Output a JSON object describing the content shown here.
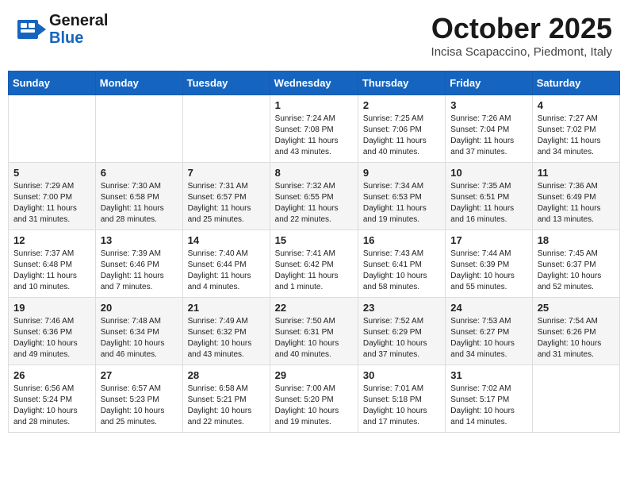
{
  "header": {
    "logo_line1": "General",
    "logo_line2": "Blue",
    "month_title": "October 2025",
    "location": "Incisa Scapaccino, Piedmont, Italy"
  },
  "weekdays": [
    "Sunday",
    "Monday",
    "Tuesday",
    "Wednesday",
    "Thursday",
    "Friday",
    "Saturday"
  ],
  "weeks": [
    [
      {
        "day": "",
        "info": ""
      },
      {
        "day": "",
        "info": ""
      },
      {
        "day": "",
        "info": ""
      },
      {
        "day": "1",
        "info": "Sunrise: 7:24 AM\nSunset: 7:08 PM\nDaylight: 11 hours and 43 minutes."
      },
      {
        "day": "2",
        "info": "Sunrise: 7:25 AM\nSunset: 7:06 PM\nDaylight: 11 hours and 40 minutes."
      },
      {
        "day": "3",
        "info": "Sunrise: 7:26 AM\nSunset: 7:04 PM\nDaylight: 11 hours and 37 minutes."
      },
      {
        "day": "4",
        "info": "Sunrise: 7:27 AM\nSunset: 7:02 PM\nDaylight: 11 hours and 34 minutes."
      }
    ],
    [
      {
        "day": "5",
        "info": "Sunrise: 7:29 AM\nSunset: 7:00 PM\nDaylight: 11 hours and 31 minutes."
      },
      {
        "day": "6",
        "info": "Sunrise: 7:30 AM\nSunset: 6:58 PM\nDaylight: 11 hours and 28 minutes."
      },
      {
        "day": "7",
        "info": "Sunrise: 7:31 AM\nSunset: 6:57 PM\nDaylight: 11 hours and 25 minutes."
      },
      {
        "day": "8",
        "info": "Sunrise: 7:32 AM\nSunset: 6:55 PM\nDaylight: 11 hours and 22 minutes."
      },
      {
        "day": "9",
        "info": "Sunrise: 7:34 AM\nSunset: 6:53 PM\nDaylight: 11 hours and 19 minutes."
      },
      {
        "day": "10",
        "info": "Sunrise: 7:35 AM\nSunset: 6:51 PM\nDaylight: 11 hours and 16 minutes."
      },
      {
        "day": "11",
        "info": "Sunrise: 7:36 AM\nSunset: 6:49 PM\nDaylight: 11 hours and 13 minutes."
      }
    ],
    [
      {
        "day": "12",
        "info": "Sunrise: 7:37 AM\nSunset: 6:48 PM\nDaylight: 11 hours and 10 minutes."
      },
      {
        "day": "13",
        "info": "Sunrise: 7:39 AM\nSunset: 6:46 PM\nDaylight: 11 hours and 7 minutes."
      },
      {
        "day": "14",
        "info": "Sunrise: 7:40 AM\nSunset: 6:44 PM\nDaylight: 11 hours and 4 minutes."
      },
      {
        "day": "15",
        "info": "Sunrise: 7:41 AM\nSunset: 6:42 PM\nDaylight: 11 hours and 1 minute."
      },
      {
        "day": "16",
        "info": "Sunrise: 7:43 AM\nSunset: 6:41 PM\nDaylight: 10 hours and 58 minutes."
      },
      {
        "day": "17",
        "info": "Sunrise: 7:44 AM\nSunset: 6:39 PM\nDaylight: 10 hours and 55 minutes."
      },
      {
        "day": "18",
        "info": "Sunrise: 7:45 AM\nSunset: 6:37 PM\nDaylight: 10 hours and 52 minutes."
      }
    ],
    [
      {
        "day": "19",
        "info": "Sunrise: 7:46 AM\nSunset: 6:36 PM\nDaylight: 10 hours and 49 minutes."
      },
      {
        "day": "20",
        "info": "Sunrise: 7:48 AM\nSunset: 6:34 PM\nDaylight: 10 hours and 46 minutes."
      },
      {
        "day": "21",
        "info": "Sunrise: 7:49 AM\nSunset: 6:32 PM\nDaylight: 10 hours and 43 minutes."
      },
      {
        "day": "22",
        "info": "Sunrise: 7:50 AM\nSunset: 6:31 PM\nDaylight: 10 hours and 40 minutes."
      },
      {
        "day": "23",
        "info": "Sunrise: 7:52 AM\nSunset: 6:29 PM\nDaylight: 10 hours and 37 minutes."
      },
      {
        "day": "24",
        "info": "Sunrise: 7:53 AM\nSunset: 6:27 PM\nDaylight: 10 hours and 34 minutes."
      },
      {
        "day": "25",
        "info": "Sunrise: 7:54 AM\nSunset: 6:26 PM\nDaylight: 10 hours and 31 minutes."
      }
    ],
    [
      {
        "day": "26",
        "info": "Sunrise: 6:56 AM\nSunset: 5:24 PM\nDaylight: 10 hours and 28 minutes."
      },
      {
        "day": "27",
        "info": "Sunrise: 6:57 AM\nSunset: 5:23 PM\nDaylight: 10 hours and 25 minutes."
      },
      {
        "day": "28",
        "info": "Sunrise: 6:58 AM\nSunset: 5:21 PM\nDaylight: 10 hours and 22 minutes."
      },
      {
        "day": "29",
        "info": "Sunrise: 7:00 AM\nSunset: 5:20 PM\nDaylight: 10 hours and 19 minutes."
      },
      {
        "day": "30",
        "info": "Sunrise: 7:01 AM\nSunset: 5:18 PM\nDaylight: 10 hours and 17 minutes."
      },
      {
        "day": "31",
        "info": "Sunrise: 7:02 AM\nSunset: 5:17 PM\nDaylight: 10 hours and 14 minutes."
      },
      {
        "day": "",
        "info": ""
      }
    ]
  ]
}
